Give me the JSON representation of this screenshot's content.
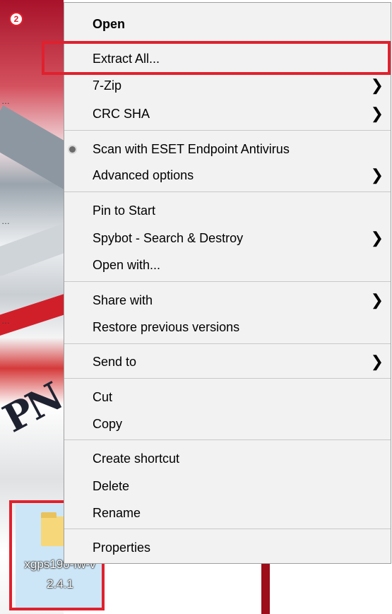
{
  "annotation": {
    "step_badge": "2"
  },
  "desktop_file": {
    "name_line1": "xgps190-fw-v",
    "name_line2": "2.4.1"
  },
  "background_fragment": "PN",
  "context_menu": {
    "items": [
      {
        "label": "Open",
        "bold": true,
        "submenu": false
      },
      {
        "label": "Extract All...",
        "submenu": false
      },
      {
        "label": "7-Zip",
        "submenu": true
      },
      {
        "label": "CRC SHA",
        "submenu": true
      },
      {
        "label": "Scan with ESET Endpoint Antivirus",
        "submenu": false,
        "radio": true
      },
      {
        "label": "Advanced options",
        "submenu": true
      },
      {
        "label": "Pin to Start",
        "submenu": false
      },
      {
        "label": "Spybot - Search & Destroy",
        "submenu": true
      },
      {
        "label": "Open with...",
        "submenu": false
      },
      {
        "label": "Share with",
        "submenu": true
      },
      {
        "label": "Restore previous versions",
        "submenu": false
      },
      {
        "label": "Send to",
        "submenu": true
      },
      {
        "label": "Cut",
        "submenu": false
      },
      {
        "label": "Copy",
        "submenu": false
      },
      {
        "label": "Create shortcut",
        "submenu": false
      },
      {
        "label": "Delete",
        "submenu": false
      },
      {
        "label": "Rename",
        "submenu": false
      },
      {
        "label": "Properties",
        "submenu": false
      }
    ],
    "submenu_arrow": "❯"
  },
  "colors": {
    "annotation_red": "#e0212e",
    "menu_bg": "#f2f2f2",
    "file_tile": "#cde6f7"
  }
}
